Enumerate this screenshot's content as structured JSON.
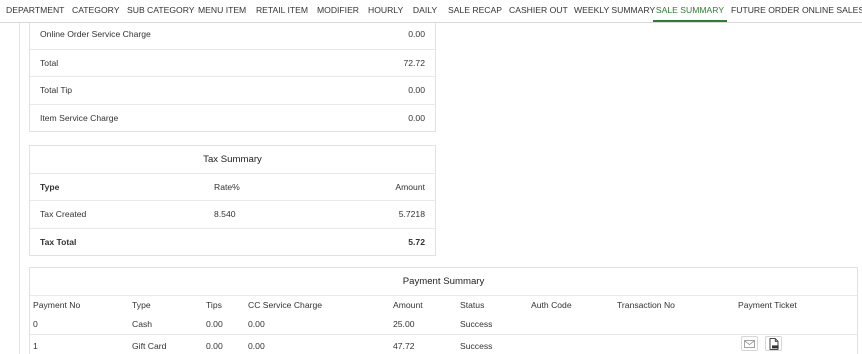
{
  "tabs": [
    {
      "label": "DEPARTMENT",
      "active": false
    },
    {
      "label": "CATEGORY",
      "active": false
    },
    {
      "label": "SUB CATEGORY",
      "active": false
    },
    {
      "label": "MENU ITEM",
      "active": false
    },
    {
      "label": "RETAIL ITEM",
      "active": false
    },
    {
      "label": "MODIFIER",
      "active": false
    },
    {
      "label": "HOURLY",
      "active": false
    },
    {
      "label": "DAILY",
      "active": false
    },
    {
      "label": "SALE RECAP",
      "active": false
    },
    {
      "label": "CASHIER OUT",
      "active": false
    },
    {
      "label": "WEEKLY SUMMARY",
      "active": false
    },
    {
      "label": "SALE SUMMARY",
      "active": true
    },
    {
      "label": "FUTURE ORDER",
      "active": false
    },
    {
      "label": "ONLINE SALES",
      "active": false
    }
  ],
  "sale_summary": {
    "rows": [
      {
        "label": "Online Order Service Charge",
        "value": "0.00"
      },
      {
        "label": "Total",
        "value": "72.72"
      },
      {
        "label": "Total Tip",
        "value": "0.00"
      },
      {
        "label": "Item Service Charge",
        "value": "0.00"
      }
    ]
  },
  "tax_summary": {
    "title": "Tax Summary",
    "headers": {
      "type": "Type",
      "rate": "Rate%",
      "amount": "Amount"
    },
    "rows": [
      {
        "type": "Tax Created",
        "rate": "8.540",
        "amount": "5.7218"
      }
    ],
    "total": {
      "label": "Tax Total",
      "amount": "5.72"
    }
  },
  "payment_summary": {
    "title": "Payment Summary",
    "headers": {
      "payment_no": "Payment No",
      "type": "Type",
      "tips": "Tips",
      "cc_service_charge": "CC Service Charge",
      "amount": "Amount",
      "status": "Status",
      "auth_code": "Auth Code",
      "transaction_no": "Transaction No",
      "payment_ticket": "Payment Ticket"
    },
    "rows": [
      {
        "payment_no": "0",
        "type": "Cash",
        "tips": "0.00",
        "cc_service_charge": "0.00",
        "amount": "25.00",
        "status": "Success",
        "auth_code": "",
        "transaction_no": "",
        "ticket_icons": []
      },
      {
        "payment_no": "1",
        "type": "Gift Card",
        "tips": "0.00",
        "cc_service_charge": "0.00",
        "amount": "47.72",
        "status": "Success",
        "auth_code": "",
        "transaction_no": "",
        "ticket_icons": [
          "email-icon",
          "pdf-icon"
        ]
      }
    ]
  },
  "colors": {
    "accent": "#2e7d32",
    "border": "#e2e2e2",
    "text": "#333333"
  }
}
